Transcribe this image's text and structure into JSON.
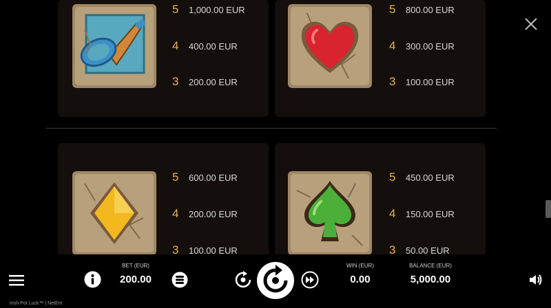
{
  "paytable": {
    "top_left": {
      "symbol_icon": "horn-icon",
      "payouts": [
        {
          "count": "5",
          "amount": "1,000.00 EUR"
        },
        {
          "count": "4",
          "amount": "400.00 EUR"
        },
        {
          "count": "3",
          "amount": "200.00 EUR"
        }
      ]
    },
    "top_right": {
      "symbol_icon": "heart-icon",
      "payouts": [
        {
          "count": "5",
          "amount": "800.00 EUR"
        },
        {
          "count": "4",
          "amount": "300.00 EUR"
        },
        {
          "count": "3",
          "amount": "100.00 EUR"
        }
      ]
    },
    "bottom_left": {
      "symbol_icon": "diamond-icon",
      "payouts": [
        {
          "count": "5",
          "amount": "600.00 EUR"
        },
        {
          "count": "4",
          "amount": "200.00 EUR"
        },
        {
          "count": "3",
          "amount": "100.00 EUR"
        }
      ]
    },
    "bottom_right": {
      "symbol_icon": "spade-icon",
      "payouts": [
        {
          "count": "5",
          "amount": "450.00 EUR"
        },
        {
          "count": "4",
          "amount": "150.00 EUR"
        },
        {
          "count": "3",
          "amount": "50.00 EUR"
        }
      ]
    }
  },
  "bottom_bar": {
    "bet_label": "BET (EUR)",
    "bet_value": "200.00",
    "win_label": "WIN (EUR)",
    "win_value": "0.00",
    "balance_label": "BALANCE (EUR)",
    "balance_value": "5,000.00"
  },
  "footer": {
    "game_name": "Irish Pot Luck™  |  NetEnt"
  },
  "colors": {
    "stone": "#b8a07c",
    "accent": "#e6b24c",
    "heart": "#d9232e",
    "diamond": "#f2b81e",
    "spade": "#4caf3a",
    "horn_frame": "#58a8bf"
  }
}
